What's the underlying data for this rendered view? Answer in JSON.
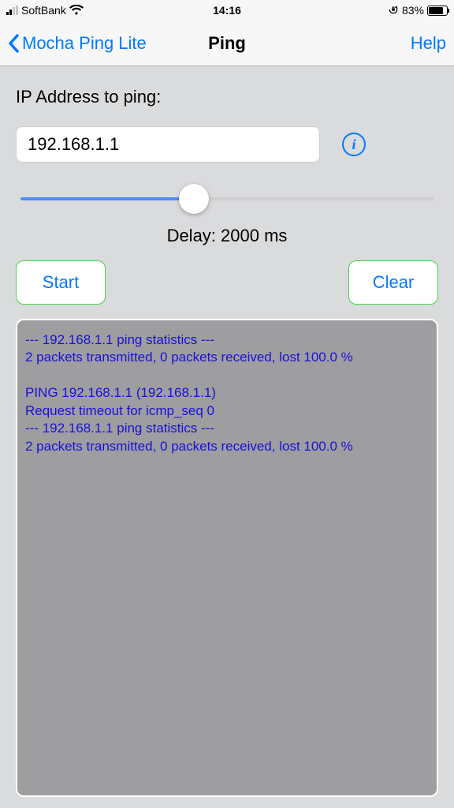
{
  "statusBar": {
    "carrier": "SoftBank",
    "time": "14:16",
    "batteryPercent": "83%",
    "batteryFillPct": 83
  },
  "nav": {
    "backLabel": "Mocha Ping Lite",
    "title": "Ping",
    "helpLabel": "Help"
  },
  "form": {
    "heading": "IP Address to ping:",
    "ipValue": "192.168.1.1",
    "sliderPercent": 42,
    "delayLabel": "Delay: 2000 ms",
    "startLabel": "Start",
    "clearLabel": "Clear"
  },
  "output": "--- 192.168.1.1 ping statistics ---\n2 packets transmitted, 0 packets received, lost 100.0 %\n\nPING 192.168.1.1 (192.168.1.1)\nRequest timeout for icmp_seq 0\n--- 192.168.1.1 ping statistics ---\n2 packets transmitted, 0 packets received, lost 100.0 %"
}
